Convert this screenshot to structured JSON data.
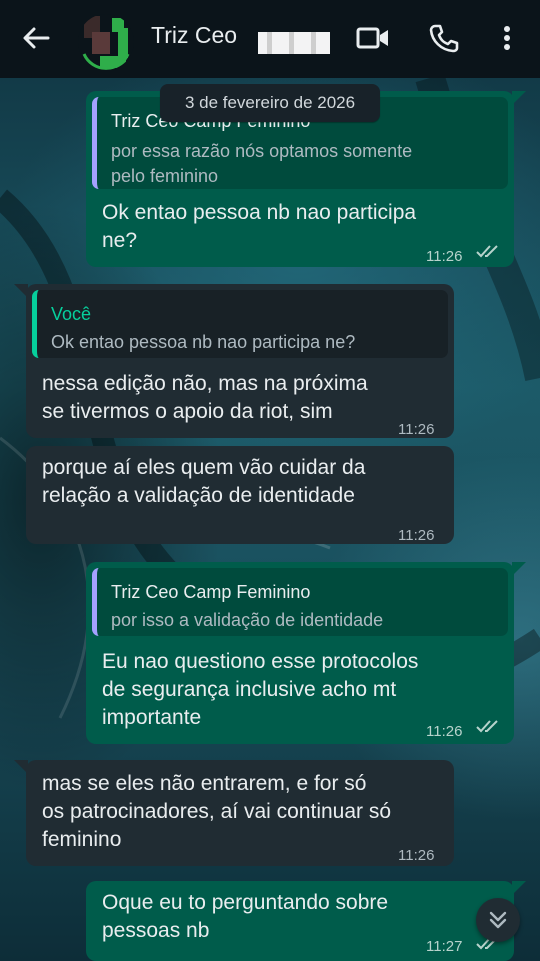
{
  "header": {
    "contact_name": "Triz Ceo",
    "accent": "#005c4b"
  },
  "date_chip": "3 de fevereiro de 2026",
  "messages": [
    {
      "direction": "outgoing",
      "quote_name": "Triz Ceo Camp Feminino",
      "quote_text": "por essa razão nós optamos somente\npelo feminino",
      "text": "Ok entao pessoa nb nao participa\nne?",
      "time": "11:26",
      "status": "read"
    },
    {
      "direction": "incoming",
      "quote_name": "Você",
      "quote_text": "Ok entao pessoa nb nao participa ne?",
      "text": "nessa edição não, mas na próxima\nse tivermos o apoio da riot, sim",
      "time": "11:26"
    },
    {
      "direction": "incoming",
      "text": "porque aí eles quem vão cuidar da\nrelação a validação de identidade",
      "time": "11:26"
    },
    {
      "direction": "outgoing",
      "quote_name": "Triz Ceo Camp Feminino",
      "quote_text": "por isso a validação de identidade",
      "text": "Eu nao questiono esse protocolos\nde segurança inclusive acho mt\nimportante",
      "time": "11:26",
      "status": "read"
    },
    {
      "direction": "incoming",
      "text": "mas se eles não entrarem, e for só\nos patrocinadores, aí vai continuar só\nfeminino",
      "time": "11:26"
    },
    {
      "direction": "outgoing",
      "text": "Oque eu to perguntando sobre\npessoas nb",
      "time": "11:27",
      "status": "read"
    }
  ]
}
